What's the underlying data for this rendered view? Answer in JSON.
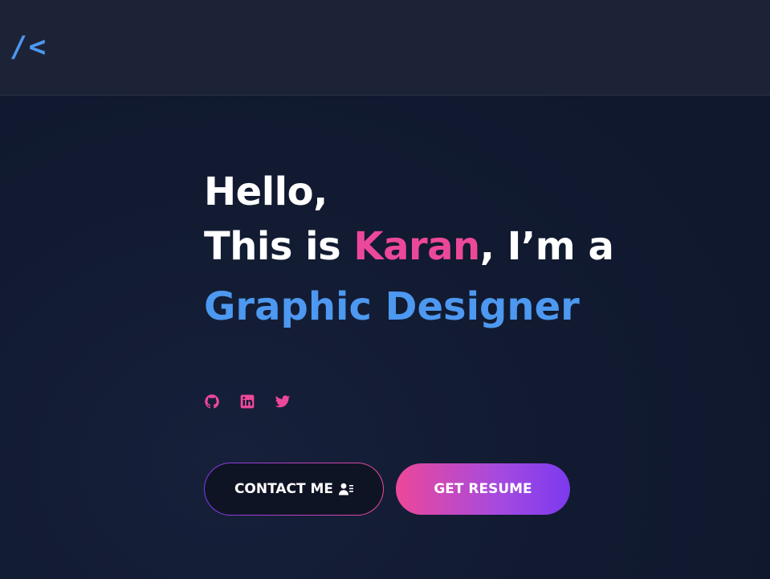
{
  "nav": {
    "logo_text": "/<"
  },
  "hero": {
    "greeting": "Hello,",
    "intro_prefix": "This is ",
    "name": "Karan",
    "intro_suffix": ", I’m a",
    "role": "Graphic Designer"
  },
  "socials": [
    {
      "icon": "github-icon"
    },
    {
      "icon": "linkedin-icon"
    },
    {
      "icon": "twitter-icon"
    }
  ],
  "buttons": {
    "contact_label": "CONTACT ME",
    "contact_icon": "contact-card-icon",
    "resume_label": "GET RESUME"
  },
  "colors": {
    "accent_pink": "#ec4899",
    "accent_blue": "#4d98f0",
    "accent_purple": "#7c3aed",
    "background": "#111a30",
    "navbar": "#1d2337"
  }
}
